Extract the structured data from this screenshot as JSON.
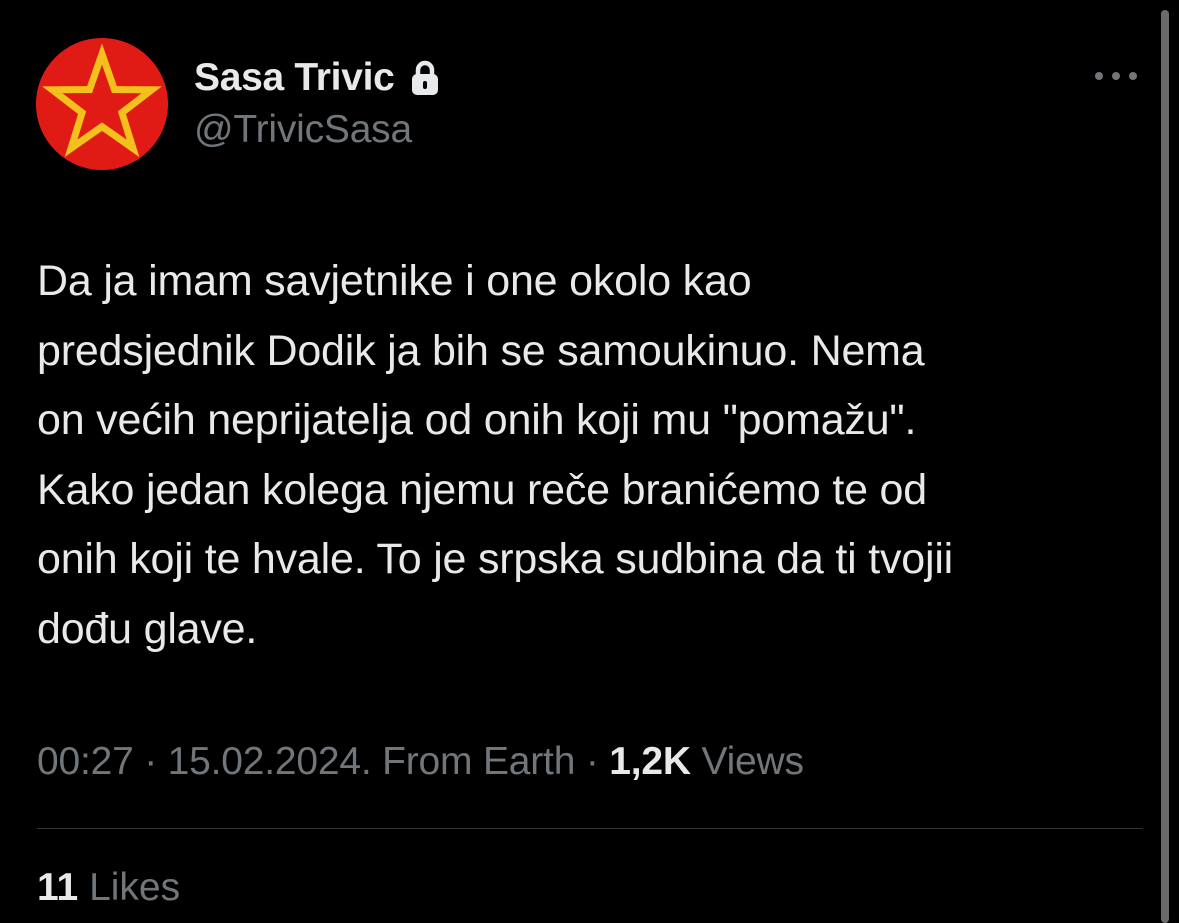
{
  "author": {
    "display_name": "Sasa Trivic",
    "handle": "@TrivicSasa",
    "avatar_icon": "red-star-icon",
    "protected_icon": "lock-icon"
  },
  "tweet": {
    "text_lines": [
      "Da ja imam savjetnike i one okolo kao",
      "predsjednik Dodik ja bih se samoukinuo. Nema",
      "on većih neprijatelja od onih koji mu \"pomažu\".",
      "Kako jedan kolega njemu reče branićemo te od",
      "onih koji te hvale. To je srpska sudbina da ti tvojii",
      "dođu glave."
    ]
  },
  "meta": {
    "time": "00:27",
    "separator_1": " · ",
    "date": "15.02.2024.",
    "source": "From Earth",
    "separator_2": " · ",
    "views_count": "1,2K",
    "views_label": "Views"
  },
  "stats": {
    "likes_count": "11",
    "likes_label": "Likes"
  },
  "menu": {
    "more_icon": "more-icon"
  },
  "colors": {
    "background": "#000000",
    "primary_text": "#e7e9ea",
    "secondary_text": "#71767b",
    "divider": "#2f3336",
    "avatar_red": "#e01a14",
    "avatar_star_gold": "#f3c01c"
  }
}
